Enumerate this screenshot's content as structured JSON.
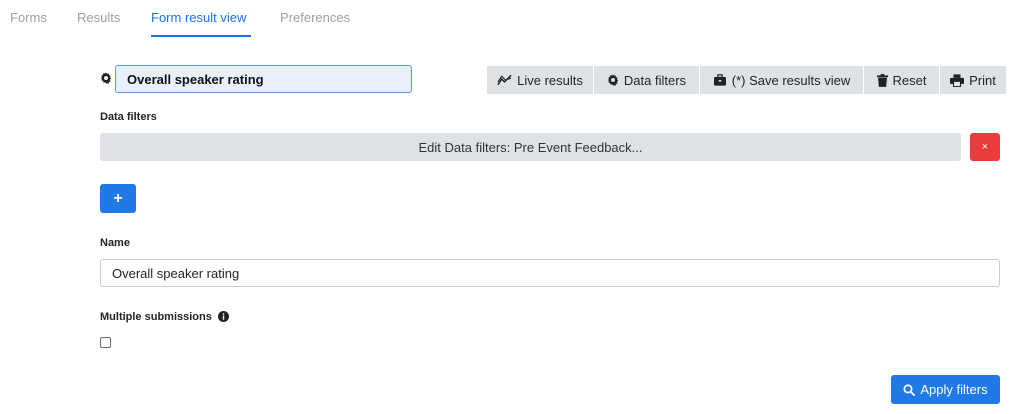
{
  "tabs": [
    {
      "label": "Forms",
      "active": false
    },
    {
      "label": "Results",
      "active": false
    },
    {
      "label": "Form result view",
      "active": true
    },
    {
      "label": "Preferences",
      "active": false
    }
  ],
  "view": {
    "title_value": "Overall speaker rating"
  },
  "toolbar": {
    "live_results": "Live results",
    "data_filters": "Data filters",
    "save_results_view": "(*) Save results view",
    "reset": "Reset",
    "print": "Print"
  },
  "data_filters": {
    "heading": "Data filters",
    "edit_label": "Edit Data filters: Pre Event Feedback...",
    "remove_label": "×",
    "add_label": "+"
  },
  "name": {
    "label": "Name",
    "value": "Overall speaker rating"
  },
  "multiple_submissions": {
    "label": "Multiple submissions",
    "checked": false
  },
  "apply_filters": "Apply filters",
  "colors": {
    "accent": "#1a73e8",
    "primary_button": "#1f7ae8",
    "danger": "#ea3c3c",
    "toolbar_bg": "#dee2e6",
    "title_input_bg": "#e8f0fe"
  }
}
